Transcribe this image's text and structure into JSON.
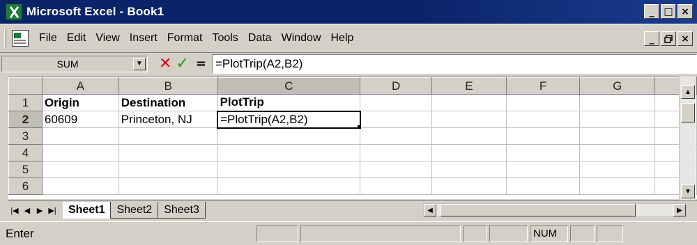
{
  "window": {
    "title": "Microsoft Excel - Book1",
    "min": "_",
    "max": "□",
    "close": "×"
  },
  "menu": {
    "items": [
      "File",
      "Edit",
      "View",
      "Insert",
      "Format",
      "Tools",
      "Data",
      "Window",
      "Help"
    ],
    "doc_min": "_",
    "doc_restore": "ᵍ",
    "doc_close": "×"
  },
  "formula": {
    "name_box": "SUM",
    "cancel": "✕",
    "enter": "✓",
    "equals": "=",
    "content": "=PlotTrip(A2,B2)"
  },
  "grid": {
    "columns": [
      "A",
      "B",
      "C",
      "D",
      "E",
      "F",
      "G"
    ],
    "rows": [
      {
        "num": "1",
        "cells": [
          "Origin",
          "Destination",
          "PlotTrip",
          "",
          "",
          "",
          ""
        ]
      },
      {
        "num": "2",
        "cells": [
          "60609",
          "Princeton, NJ",
          "=PlotTrip(A2,B2)",
          "",
          "",
          "",
          ""
        ]
      },
      {
        "num": "3",
        "cells": [
          "",
          "",
          "",
          "",
          "",
          "",
          ""
        ]
      },
      {
        "num": "4",
        "cells": [
          "",
          "",
          "",
          "",
          "",
          "",
          ""
        ]
      },
      {
        "num": "5",
        "cells": [
          "",
          "",
          "",
          "",
          "",
          "",
          ""
        ]
      },
      {
        "num": "6",
        "cells": [
          "",
          "",
          "",
          "",
          "",
          "",
          ""
        ]
      }
    ]
  },
  "sheets": {
    "tabs": [
      "Sheet1",
      "Sheet2",
      "Sheet3"
    ],
    "active": "Sheet1"
  },
  "status": {
    "mode": "Enter",
    "num": "NUM"
  }
}
